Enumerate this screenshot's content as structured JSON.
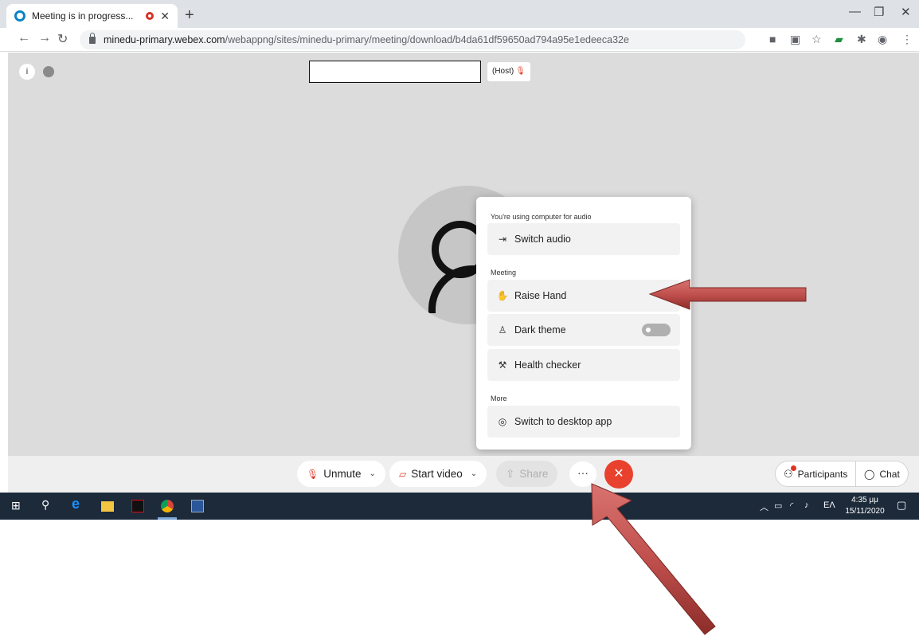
{
  "browser": {
    "tab_title": "Meeting is in progress...",
    "new_tab_icon": "plus-icon",
    "url_host": "minedu-primary.webex.com",
    "url_path": "/webappng/sites/minedu-primary/meeting/download/b4da61df59650ad794a95e1edeeca32e"
  },
  "meeting": {
    "host_label": "(Host)",
    "menu": {
      "audio_section": "You're using computer for audio",
      "switch_audio": "Switch audio",
      "meeting_section": "Meeting",
      "raise_hand": "Raise Hand",
      "dark_theme": "Dark theme",
      "dark_theme_enabled": false,
      "health_checker": "Health checker",
      "more_section": "More",
      "switch_desktop": "Switch to desktop app"
    },
    "controls": {
      "unmute": "Unmute",
      "start_video": "Start video",
      "share": "Share",
      "more": "···",
      "end": "✕",
      "participants": "Participants",
      "chat": "Chat"
    }
  },
  "taskbar": {
    "lang": "ΕΛ",
    "time": "4:35 μμ",
    "date": "15/11/2020"
  },
  "colors": {
    "end_call": "#e8412e",
    "arrow": "#c0504d",
    "taskbar": "#1c2a3a"
  }
}
